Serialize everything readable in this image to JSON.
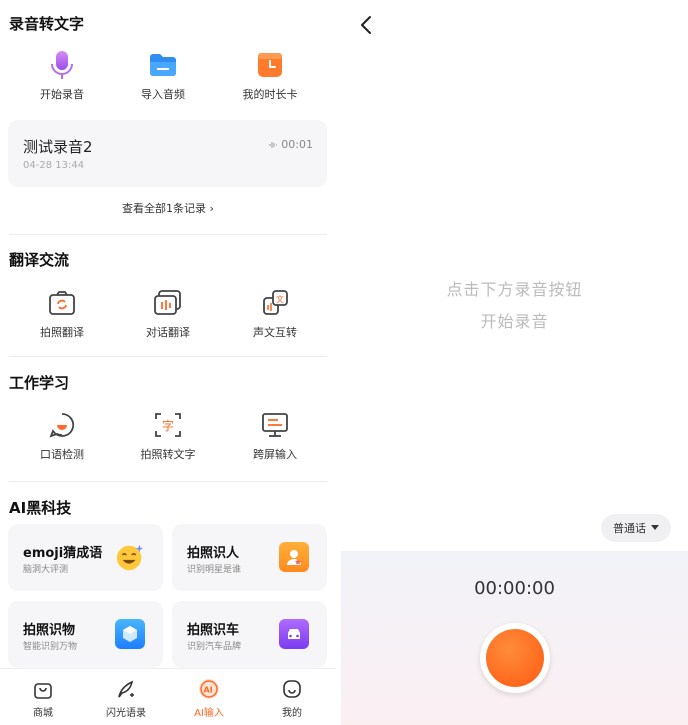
{
  "left": {
    "sections": {
      "rec_title": "录音转文字",
      "trans_title": "翻译交流",
      "work_title": "工作学习",
      "ai_title": "AI黑科技"
    },
    "rec_actions": [
      {
        "label": "开始录音",
        "icon": "microphone-icon"
      },
      {
        "label": "导入音频",
        "icon": "folder-icon"
      },
      {
        "label": "我的时长卡",
        "icon": "clock-card-icon"
      }
    ],
    "record": {
      "name": "测试录音2",
      "time": "04-28 13:44",
      "duration": "00:01"
    },
    "view_all": "查看全部1条记录 ›",
    "trans_actions": [
      {
        "label": "拍照翻译",
        "icon": "camera-translate-icon"
      },
      {
        "label": "对话翻译",
        "icon": "dialog-translate-icon"
      },
      {
        "label": "声文互转",
        "icon": "voice-text-convert-icon"
      }
    ],
    "work_actions": [
      {
        "label": "口语检测",
        "icon": "speech-check-icon"
      },
      {
        "label": "拍照转文字",
        "icon": "photo-to-text-icon"
      },
      {
        "label": "跨屏输入",
        "icon": "cross-screen-icon"
      }
    ],
    "ai_cards": [
      {
        "title": "emoji猜成语",
        "sub": "脑洞大评测",
        "icon": "emoji-icon"
      },
      {
        "title": "拍照识人",
        "sub": "识别明星是谁",
        "icon": "person-id-icon"
      },
      {
        "title": "拍照识物",
        "sub": "智能识别万物",
        "icon": "object-id-icon"
      },
      {
        "title": "拍照识车",
        "sub": "识别汽车品牌",
        "icon": "car-id-icon"
      }
    ],
    "tabs": [
      {
        "label": "商城",
        "icon": "shop-bag-icon"
      },
      {
        "label": "闪光语录",
        "icon": "feather-icon"
      },
      {
        "label": "AI输入",
        "icon": "ai-input-icon"
      },
      {
        "label": "我的",
        "icon": "profile-icon"
      }
    ],
    "active_tab": "AI输入"
  },
  "right": {
    "hint_line1": "点击下方录音按钮",
    "hint_line2": "开始录音",
    "language": "普通话",
    "timer": "00:00:00"
  },
  "colors": {
    "accent": "#ff6a2b",
    "record_button": "#ff5a12"
  }
}
